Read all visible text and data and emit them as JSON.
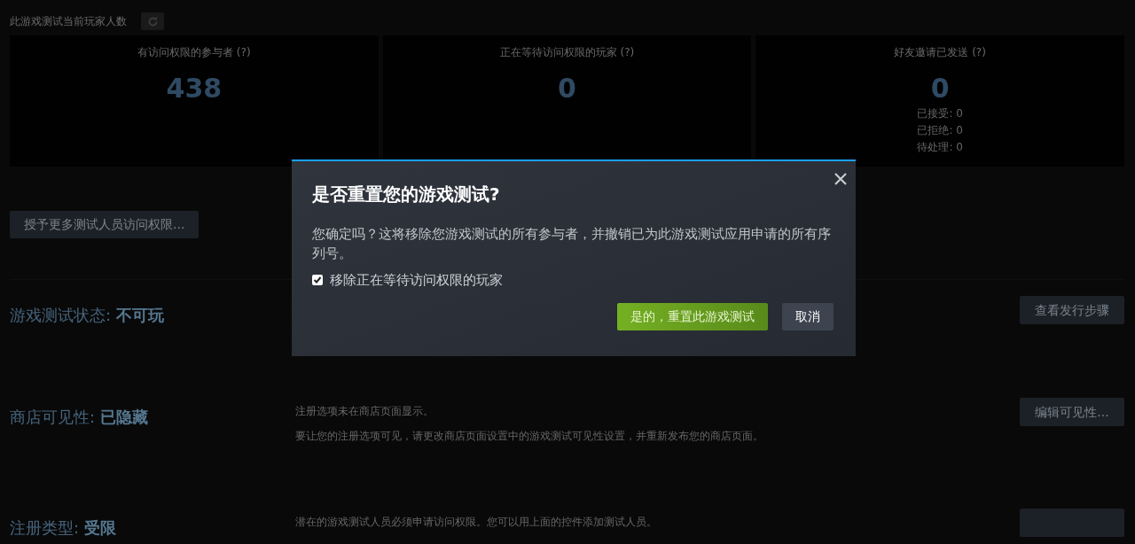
{
  "header": {
    "title": "此游戏测试当前玩家人数"
  },
  "stats": [
    {
      "label": "有访问权限的参与者 (?)",
      "value": "438"
    },
    {
      "label": "正在等待访问权限的玩家 (?)",
      "value": "0"
    },
    {
      "label": "好友邀请已发送 (?)",
      "value": "0",
      "details": [
        "已接受: 0",
        "已拒绝: 0",
        "待处理: 0"
      ]
    }
  ],
  "grant_button": "授予更多测试人员访问权限...",
  "sections": [
    {
      "label": "游戏测试状态: **不可玩**",
      "button": "查看发行步骤"
    },
    {
      "label": "商店可见性: **已隐藏**",
      "descriptions": [
        "注册选项未在商店页面显示。",
        "要让您的注册选项可见，请更改商店页面设置中的游戏测试可见性设置，并重新发布您的商店页面。"
      ],
      "button": "编辑可见性..."
    },
    {
      "label": "注册类型: **受限**",
      "descriptions": [
        "潜在的游戏测试人员必须申请访问权限。您可以用上面的控件添加测试人员。"
      ]
    }
  ],
  "dialog": {
    "title": "是否重置您的游戏测试?",
    "message": "您确定吗？这将移除您游戏测试的所有参与者，并撤销已为此游戏测试应用申请的所有序列号。",
    "checkbox": {
      "label": "移除正在等待访问权限的玩家",
      "checked": true
    },
    "buttons": [
      {
        "label": "是的，重置此游戏测试",
        "kind": "primary"
      },
      {
        "label": "取消",
        "kind": "secondary"
      }
    ]
  }
}
